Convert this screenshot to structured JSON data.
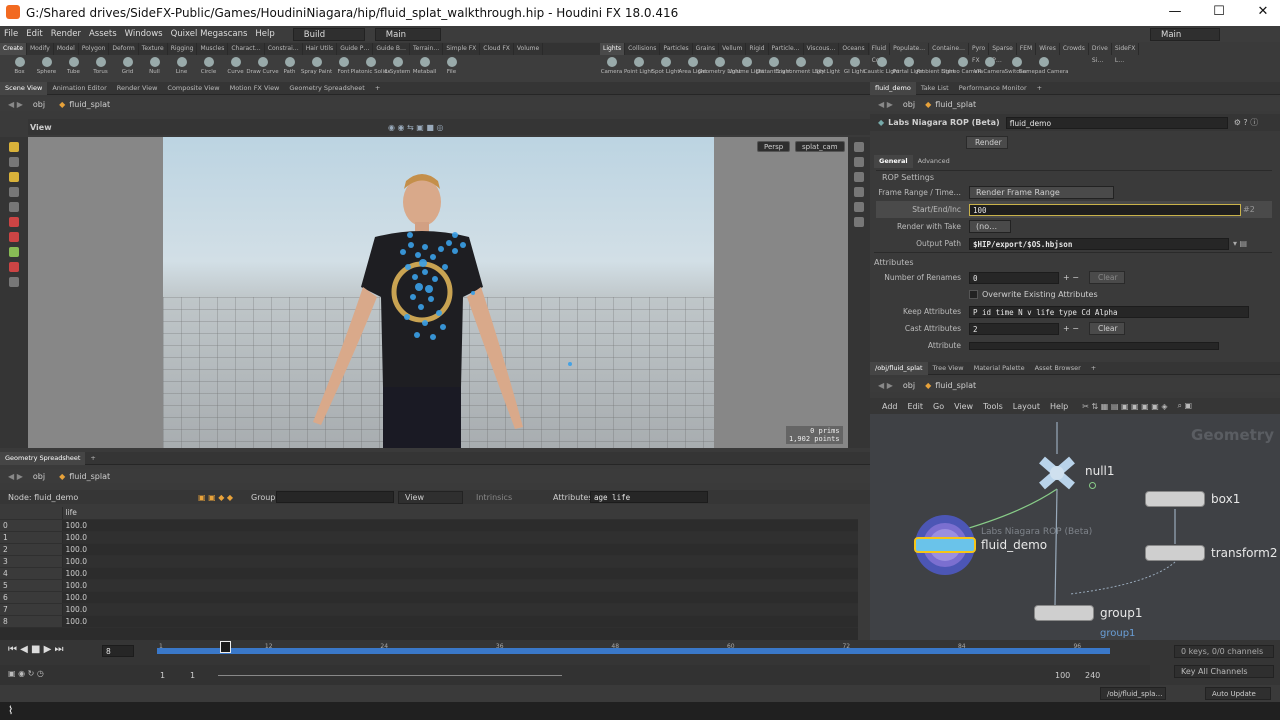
{
  "window": {
    "title": "G:/Shared drives/SideFX-Public/Games/HoudiniNiagara/hip/fluid_splat_walkthrough.hip - Houdini FX 18.0.416",
    "minimize": "—",
    "maximize": "☐",
    "close": "✕"
  },
  "menu": [
    "File",
    "Edit",
    "Render",
    "Assets",
    "Windows",
    "Quixel Megascans",
    "Help"
  ],
  "desktop_left": "Build",
  "desktop_mid": "Main",
  "desktop_right": "Main",
  "shelf_tabs_left": [
    "Create",
    "Modify",
    "Model",
    "Polygon",
    "Deform",
    "Texture",
    "Rigging",
    "Muscles",
    "Charact…",
    "Constrai…",
    "Hair Utils",
    "Guide P…",
    "Guide B…",
    "Terrain…",
    "Simple FX",
    "Cloud FX",
    "Volume"
  ],
  "shelf_tabs_right": [
    "Lights an…",
    "Collisions",
    "Particles",
    "Grains",
    "Vellum",
    "Rigid Bo…",
    "Particle…",
    "Viscous…",
    "Oceans",
    "Fluid Co…",
    "Populate…",
    "Containe…",
    "Pyro FX",
    "Sparse P…",
    "FEM",
    "Wires",
    "Crowds",
    "Drive Si…",
    "SideFX L…"
  ],
  "tools_left": [
    "Box",
    "Sphere",
    "Tube",
    "Torus",
    "Grid",
    "Null",
    "Line",
    "Circle",
    "Curve",
    "Draw Curve",
    "Path",
    "Spray Paint",
    "Font",
    "Platonic Solids",
    "L-System",
    "Metaball",
    "File"
  ],
  "tools_right": [
    "Camera",
    "Point Light",
    "Spot Light",
    "Area Light",
    "Geometry Light",
    "Volume Light",
    "Distant Light",
    "Environment Light",
    "Sky Light",
    "GI Light",
    "Caustic Light",
    "Portal Light",
    "Ambient Light",
    "Stereo Camera",
    "VR Camera",
    "Switcher",
    "Gamepad Camera"
  ],
  "left_panes": [
    "Scene View",
    "Animation Editor",
    "Render View",
    "Composite View",
    "Motion FX View",
    "Geometry Spreadsheet"
  ],
  "path_obj": "obj",
  "path_node": "fluid_splat",
  "viewport": {
    "label": "View",
    "persp": "Persp",
    "cam": "splat_cam",
    "prims": "0  prims",
    "points": "1,902 points"
  },
  "spreadsheet": {
    "tab": "Geometry Spreadsheet",
    "node": "Node: fluid_demo",
    "group_label": "Group:",
    "view": "View",
    "intrinsics": "Intrinsics",
    "attributes_label": "Attributes:",
    "attributes": "age life",
    "column": "life",
    "rows": [
      [
        "0",
        "100.0"
      ],
      [
        "1",
        "100.0"
      ],
      [
        "2",
        "100.0"
      ],
      [
        "3",
        "100.0"
      ],
      [
        "4",
        "100.0"
      ],
      [
        "5",
        "100.0"
      ],
      [
        "6",
        "100.0"
      ],
      [
        "7",
        "100.0"
      ],
      [
        "8",
        "100.0"
      ]
    ]
  },
  "right_panes": [
    "fluid_demo",
    "Take List",
    "Performance Monitor"
  ],
  "params": {
    "path_obj": "obj",
    "path_node": "fluid_splat",
    "node_type": "Labs Niagara ROP (Beta)",
    "node_name": "fluid_demo",
    "render": "Render",
    "tab_general": "General",
    "tab_advanced": "Advanced",
    "rop_settings": "ROP Settings",
    "frame_range_label": "Frame Range / Time…",
    "frame_range_value": "Render Frame Range",
    "start_label": "Start/End/Inc",
    "start_value": "100",
    "start_suffix": "#2",
    "take_label": "Render with Take",
    "take_value": "(no…",
    "output_label": "Output Path",
    "output_value": "$HIP/export/$OS.hbjson",
    "attributes": "Attributes",
    "renames_label": "Number of Renames",
    "renames_value": "0",
    "clear": "Clear",
    "overwrite": "Overwrite Existing Attributes",
    "keep_label": "Keep Attributes",
    "keep_value": "P id time N v life type Cd Alpha",
    "cast_label": "Cast Attributes",
    "cast_value": "2",
    "attribute_label": "Attribute"
  },
  "network_panes": [
    "/obj/fluid_splat",
    "Tree View",
    "Material Palette",
    "Asset Browser"
  ],
  "network": {
    "path_obj": "obj",
    "path_node": "fluid_splat",
    "menu": [
      "Add",
      "Edit",
      "Go",
      "View",
      "Tools",
      "Layout",
      "Help"
    ],
    "context": "Geometry",
    "null": "null1",
    "box": "box1",
    "transform": "transform2",
    "rop_type": "Labs Niagara ROP (Beta)",
    "rop_name": "fluid_demo",
    "group": "group1",
    "group_below": "group1"
  },
  "timeline": {
    "frame": "8",
    "ticks": [
      "1",
      "12",
      "24",
      "36",
      "48",
      "60",
      "72",
      "84",
      "96"
    ],
    "start": "1",
    "start2": "1",
    "end": "100",
    "end2": "240",
    "keys": "0 keys, 0/0 channels",
    "key_all": "Key All Channels"
  },
  "status": {
    "path": "/obj/fluid_spla…",
    "update": "Auto Update"
  }
}
